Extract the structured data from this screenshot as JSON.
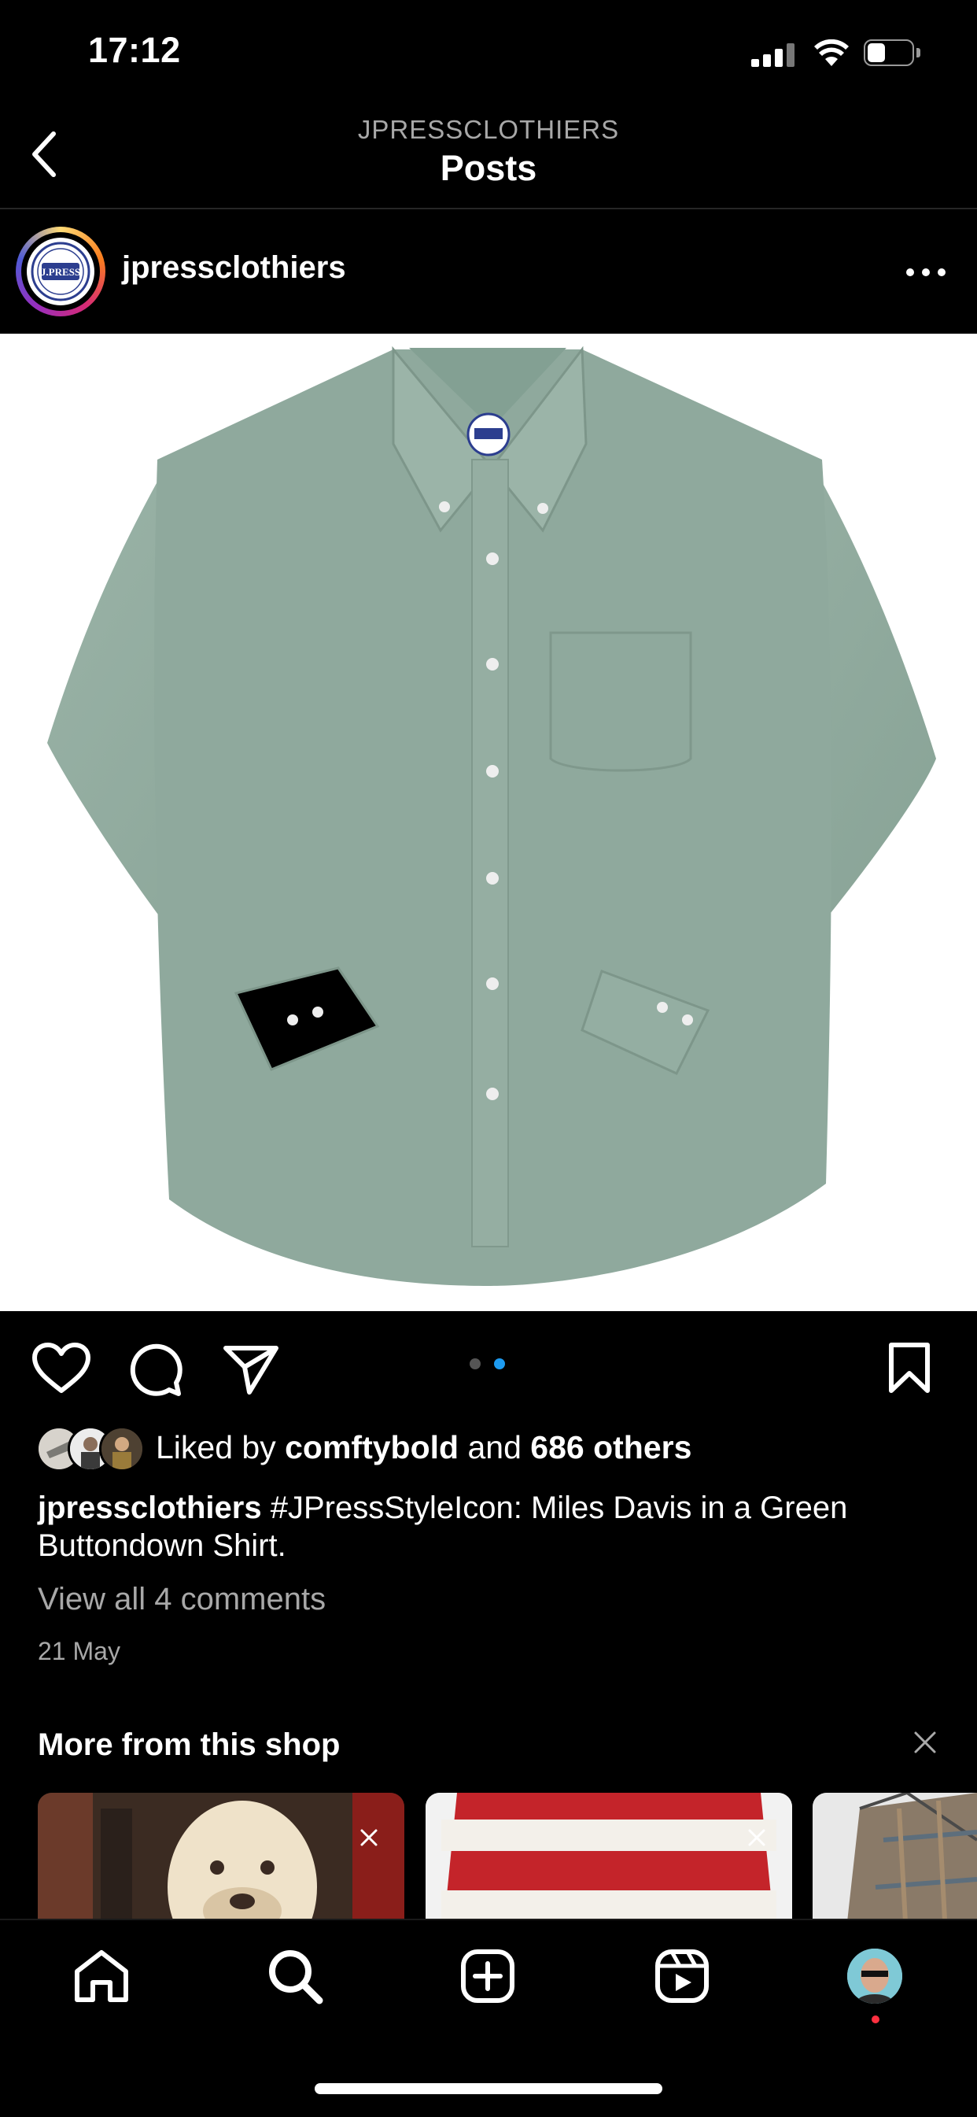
{
  "status_bar": {
    "time": "17:12"
  },
  "header": {
    "subtitle": "JPRESSCLOTHIERS",
    "title": "Posts"
  },
  "post": {
    "username": "jpressclothiers",
    "logo_text": "J.PRESS",
    "likes": {
      "prefix": "Liked by",
      "user": "comftybold",
      "middle": "and",
      "others": "686 others"
    },
    "caption": {
      "user": "jpressclothiers",
      "text": "#JPressStyleIcon: Miles Davis in a Green Buttondown Shirt."
    },
    "view_comments": "View all 4 comments",
    "date": "21 May",
    "carousel": {
      "count": 2,
      "active_index": 1
    }
  },
  "more_from_shop": {
    "title": "More from this shop"
  },
  "icons": [
    "back-icon",
    "more-icon",
    "heart-icon",
    "comment-icon",
    "share-icon",
    "bookmark-icon",
    "close-icon",
    "home-icon",
    "search-icon",
    "create-icon",
    "reels-icon",
    "profile-avatar"
  ],
  "colors": {
    "background": "#000000",
    "secondary_text": "#a8a8a8",
    "active_dot": "#1d9bf0",
    "shirt": "#8fa99d",
    "notification_dot": "#ff3040"
  }
}
